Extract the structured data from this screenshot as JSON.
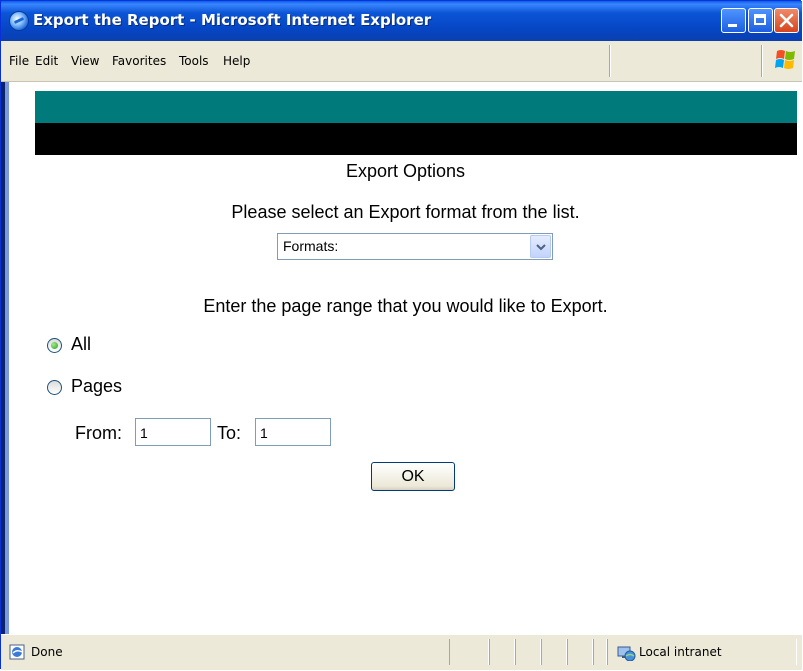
{
  "window": {
    "title": "Export the Report - Microsoft Internet Explorer",
    "icon": "ie-icon"
  },
  "menu": {
    "items": [
      "File",
      "Edit",
      "View",
      "Favorites",
      "Tools",
      "Help"
    ]
  },
  "page": {
    "heading": "Export Options",
    "instruction": "Please select an Export format from the list.",
    "format_select": {
      "value": "Formats:"
    },
    "range_prompt": "Enter the page range that you would like to Export.",
    "radio_all": {
      "label": "All",
      "checked": true
    },
    "radio_pages": {
      "label": "Pages",
      "checked": false
    },
    "from_label": "From:",
    "from_value": "1",
    "to_label": "To:",
    "to_value": "1",
    "ok_label": "OK",
    "colors": {
      "band_top": "#007a7a",
      "band_bottom": "#000000"
    }
  },
  "status": {
    "text": "Done",
    "zone": "Local intranet"
  }
}
